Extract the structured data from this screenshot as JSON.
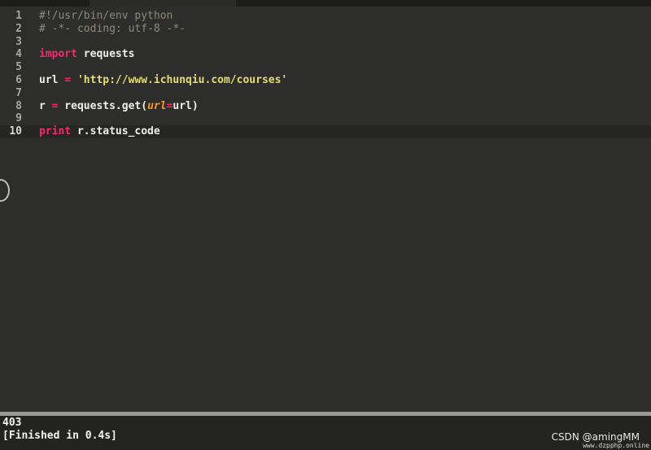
{
  "editor": {
    "lines": [
      {
        "num": "1",
        "tokens": [
          {
            "t": "#!/usr/bin/env python",
            "k": "comment"
          }
        ]
      },
      {
        "num": "2",
        "tokens": [
          {
            "t": "# -*- coding: utf-8 -*-",
            "k": "comment"
          }
        ]
      },
      {
        "num": "3",
        "tokens": []
      },
      {
        "num": "4",
        "tokens": [
          {
            "t": "import",
            "k": "keyword"
          },
          {
            "t": " requests",
            "k": "plain"
          }
        ]
      },
      {
        "num": "5",
        "tokens": []
      },
      {
        "num": "6",
        "tokens": [
          {
            "t": "url ",
            "k": "plain"
          },
          {
            "t": "=",
            "k": "op"
          },
          {
            "t": " ",
            "k": "plain"
          },
          {
            "t": "'http://www.ichunqiu.com/courses'",
            "k": "string"
          }
        ]
      },
      {
        "num": "7",
        "tokens": []
      },
      {
        "num": "8",
        "tokens": [
          {
            "t": "r ",
            "k": "plain"
          },
          {
            "t": "=",
            "k": "op"
          },
          {
            "t": " requests.get(",
            "k": "plain"
          },
          {
            "t": "url",
            "k": "param"
          },
          {
            "t": "=",
            "k": "op"
          },
          {
            "t": "url)",
            "k": "plain"
          }
        ]
      },
      {
        "num": "9",
        "tokens": []
      },
      {
        "num": "10",
        "tokens": [
          {
            "t": "print",
            "k": "keyword"
          },
          {
            "t": " r.status_code",
            "k": "plain"
          }
        ],
        "current": true
      }
    ]
  },
  "output": {
    "lines": [
      "403",
      "[Finished in 0.4s]"
    ]
  },
  "watermark": {
    "main": "CSDN @amingMM",
    "sub": "www.dzpphp.online"
  },
  "colors": {
    "background": "#2d2d2b",
    "keyword": "#f92672",
    "string": "#e6db74",
    "param": "#fd971f",
    "comment": "#8c8b79"
  }
}
